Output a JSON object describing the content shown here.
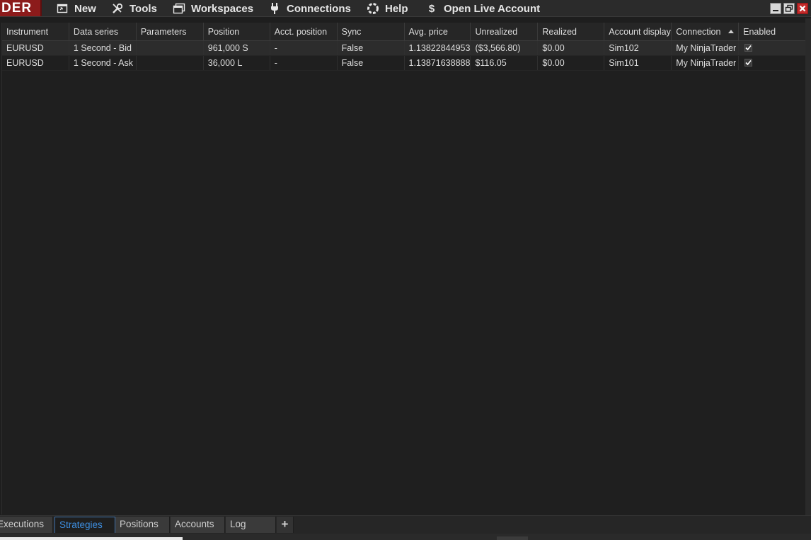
{
  "menu": {
    "logo": "DER",
    "items": [
      {
        "label": "New",
        "icon": "new-window-icon"
      },
      {
        "label": "Tools",
        "icon": "tools-icon"
      },
      {
        "label": "Workspaces",
        "icon": "workspaces-icon"
      },
      {
        "label": "Connections",
        "icon": "plug-icon"
      },
      {
        "label": "Help",
        "icon": "help-ring-icon"
      },
      {
        "label": "Open Live Account",
        "icon": "dollar-icon"
      }
    ]
  },
  "grid": {
    "columns": [
      "Instrument",
      "Data series",
      "Parameters",
      "Position",
      "Acct. position",
      "Sync",
      "Avg. price",
      "Unrealized",
      "Realized",
      "Account display",
      "Connection",
      "Enabled"
    ],
    "sorted_column": "Connection",
    "rows": [
      {
        "instrument": "EURUSD",
        "data_series": "1 Second - Bid",
        "parameters": "",
        "position": "961,000 S",
        "acct_position": "-",
        "sync": "False",
        "avg_price": "1.13822844953",
        "unrealized": "($3,566.80)",
        "realized": "$0.00",
        "account": "Sim102",
        "connection": "My NinjaTrader",
        "enabled": true
      },
      {
        "instrument": "EURUSD",
        "data_series": "1 Second - Ask",
        "parameters": "",
        "position": "36,000 L",
        "acct_position": "-",
        "sync": "False",
        "avg_price": "1.13871638888",
        "unrealized": "$116.05",
        "realized": "$0.00",
        "account": "Sim101",
        "connection": "My NinjaTrader",
        "enabled": true
      }
    ]
  },
  "tabs": {
    "items": [
      "Executions",
      "Strategies",
      "Positions",
      "Accounts",
      "Log"
    ],
    "active": "Strategies",
    "add_label": "+"
  },
  "colors": {
    "logo_bg": "#8c1b1b",
    "active_tab_text": "#3d8ee0",
    "background": "#1e1e1e"
  }
}
